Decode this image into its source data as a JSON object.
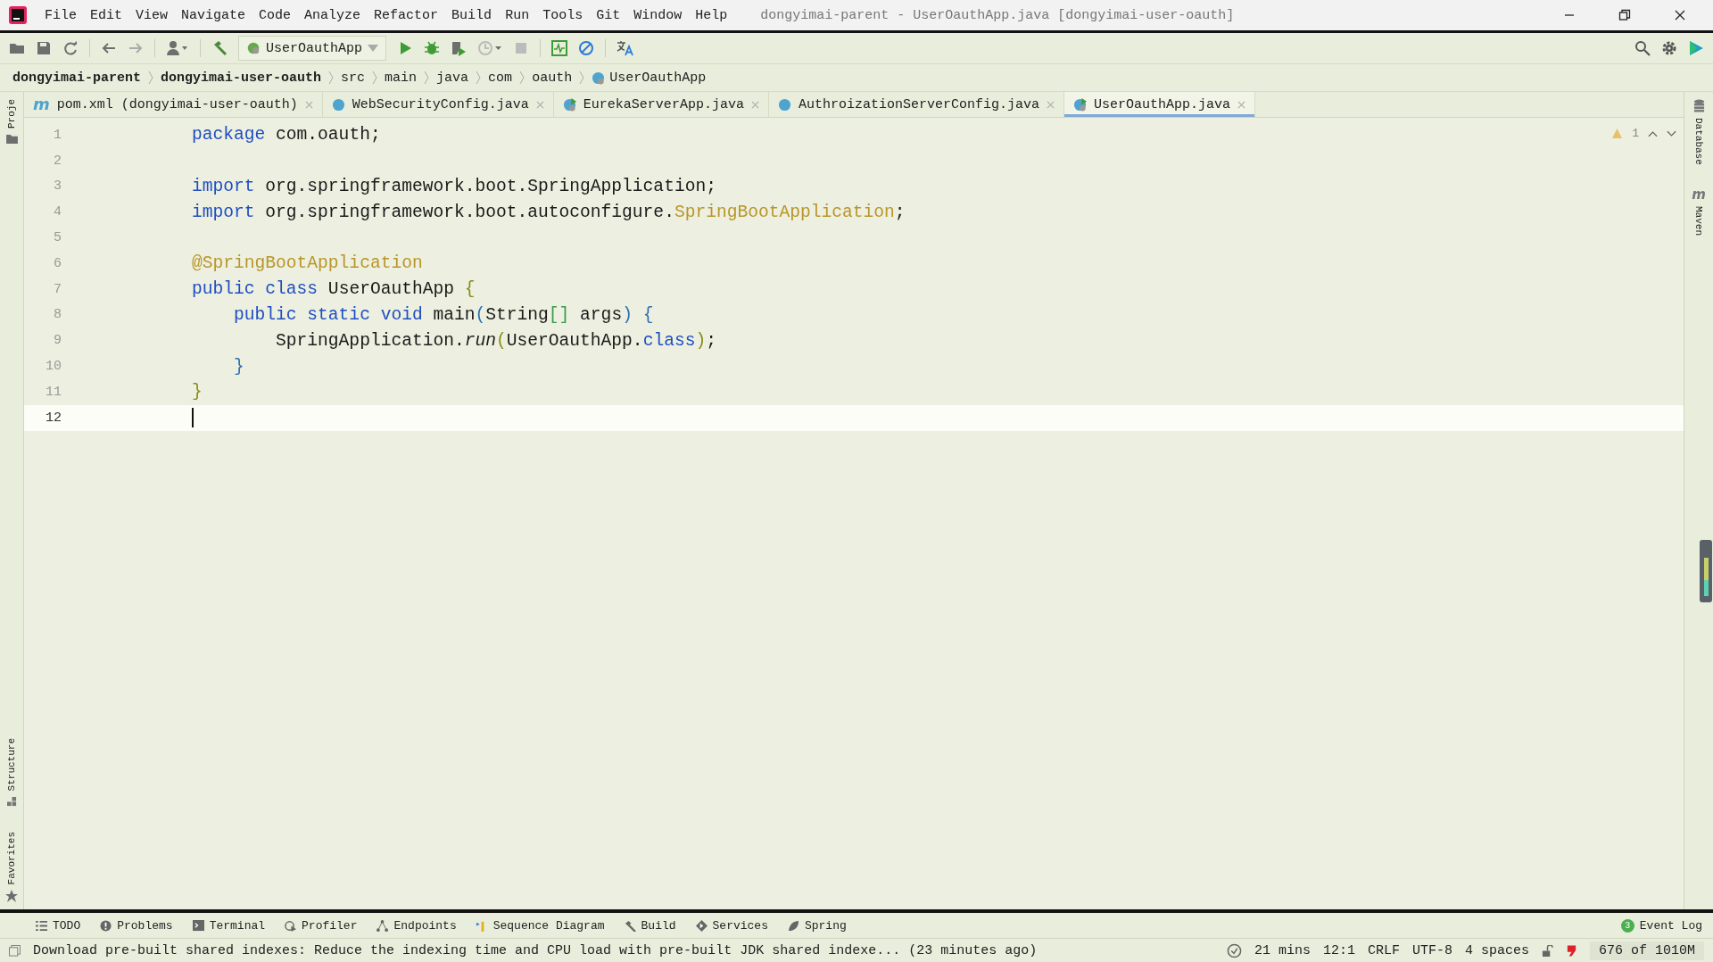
{
  "window": {
    "title": "dongyimai-parent - UserOauthApp.java [dongyimai-user-oauth]"
  },
  "menu_bar": [
    "File",
    "Edit",
    "View",
    "Navigate",
    "Code",
    "Analyze",
    "Refactor",
    "Build",
    "Run",
    "Tools",
    "Git",
    "Window",
    "Help"
  ],
  "toolbar": {
    "run_config": "UserOauthApp"
  },
  "breadcrumbs": [
    {
      "label": "dongyimai-parent",
      "kind": "bold"
    },
    {
      "label": "dongyimai-user-oauth",
      "kind": "bold"
    },
    {
      "label": "src",
      "kind": "plain"
    },
    {
      "label": "main",
      "kind": "plain"
    },
    {
      "label": "java",
      "kind": "plain"
    },
    {
      "label": "com",
      "kind": "plain"
    },
    {
      "label": "oauth",
      "kind": "plain"
    },
    {
      "label": "UserOauthApp",
      "kind": "class"
    }
  ],
  "tabs": [
    {
      "label": "pom.xml (dongyimai-user-oauth)",
      "kind": "maven",
      "icon": "m",
      "selected": false
    },
    {
      "label": "WebSecurityConfig.java",
      "kind": "class",
      "selected": false
    },
    {
      "label": "EurekaServerApp.java",
      "kind": "app",
      "selected": false
    },
    {
      "label": "AuthroizationServerConfig.java",
      "kind": "class",
      "selected": false
    },
    {
      "label": "UserOauthApp.java",
      "kind": "app",
      "selected": true
    }
  ],
  "left_strip": [
    "Proje",
    "Structure",
    "Favorites"
  ],
  "right_strip": [
    {
      "label": "Database",
      "kind": "database"
    },
    {
      "label": "Maven",
      "kind": "maven",
      "icon": "m"
    }
  ],
  "editor": {
    "warnings": "1",
    "lines": [
      {
        "number": "1",
        "current": false,
        "tokens": [
          {
            "kind": "kw",
            "text": "package"
          },
          {
            "kind": "plain",
            "text": " com.oauth;"
          }
        ]
      },
      {
        "number": "2",
        "current": false
      },
      {
        "number": "3",
        "current": false,
        "tokens": [
          {
            "kind": "kw",
            "text": "import"
          },
          {
            "kind": "plain",
            "text": " org.springframework.boot.SpringApplication;"
          }
        ]
      },
      {
        "number": "4",
        "current": false,
        "tokens": [
          {
            "kind": "kw",
            "text": "import"
          },
          {
            "kind": "plain",
            "text": " org.springframework.boot.autoconfigure."
          },
          {
            "kind": "ann",
            "text": "SpringBootApplication"
          },
          {
            "kind": "plain",
            "text": ";"
          }
        ]
      },
      {
        "number": "5",
        "current": false
      },
      {
        "number": "6",
        "current": false,
        "tokens": [
          {
            "kind": "ann",
            "text": "@SpringBootApplication"
          }
        ]
      },
      {
        "number": "7",
        "current": false,
        "tokens": [
          {
            "kind": "kw",
            "text": "public class"
          },
          {
            "kind": "plain",
            "text": " UserOauthApp "
          },
          {
            "kind": "br1",
            "text": "{"
          }
        ]
      },
      {
        "number": "8",
        "current": false,
        "tokens": [
          {
            "kind": "kw",
            "text": "    public static void"
          },
          {
            "kind": "plain",
            "text": " main"
          },
          {
            "kind": "br2",
            "text": "("
          },
          {
            "kind": "plain",
            "text": "String"
          },
          {
            "kind": "br3",
            "text": "[]"
          },
          {
            "kind": "plain",
            "text": " args"
          },
          {
            "kind": "br2",
            "text": ") {"
          }
        ]
      },
      {
        "number": "9",
        "current": false,
        "tokens": [
          {
            "kind": "plain",
            "text": "        SpringApplication."
          },
          {
            "kind": "call",
            "text": "run"
          },
          {
            "kind": "br1",
            "text": "("
          },
          {
            "kind": "plain",
            "text": "UserOauthApp."
          },
          {
            "kind": "kw",
            "text": "class"
          },
          {
            "kind": "br1",
            "text": ")"
          },
          {
            "kind": "plain",
            "text": ";"
          }
        ]
      },
      {
        "number": "10",
        "current": false,
        "tokens": [
          {
            "kind": "br2",
            "text": "    }"
          }
        ]
      },
      {
        "number": "11",
        "current": false,
        "tokens": [
          {
            "kind": "br1",
            "text": "}"
          }
        ]
      },
      {
        "number": "12",
        "current": true
      }
    ]
  },
  "tool_windows": [
    {
      "label": "TODO",
      "kind": "list"
    },
    {
      "label": "Problems",
      "kind": "alert"
    },
    {
      "label": "Terminal",
      "kind": "terminal"
    },
    {
      "label": "Profiler",
      "kind": "profiler"
    },
    {
      "label": "Endpoints",
      "kind": "endpoints"
    },
    {
      "label": "Sequence Diagram",
      "kind": "sequence"
    },
    {
      "label": "Build",
      "kind": "hammer"
    },
    {
      "label": "Services",
      "kind": "services"
    },
    {
      "label": "Spring",
      "kind": "leaf"
    }
  ],
  "event_log": {
    "label": "Event Log",
    "count": "3"
  },
  "status_bar": {
    "message": "Download pre-built shared indexes: Reduce the indexing time and CPU load with pre-built JDK shared indexe... (23 minutes ago)",
    "items": [
      "21 mins",
      "12:1",
      "CRLF",
      "UTF-8",
      "4 spaces"
    ],
    "memory": "676 of 1010M"
  }
}
